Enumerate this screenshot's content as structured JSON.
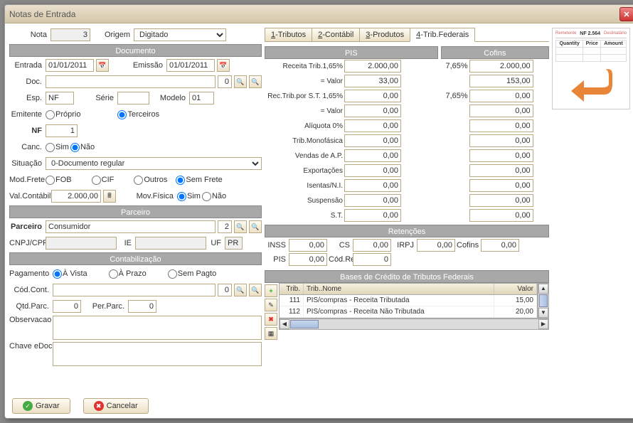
{
  "title": "Notas de Entrada",
  "header": {
    "nota_lbl": "Nota",
    "nota": "3",
    "origem_lbl": "Origem",
    "origem": "Digitado"
  },
  "tabs": [
    "1-Tributos",
    "2-Contábil",
    "3-Produtos",
    "4-Trib.Federais"
  ],
  "documento": {
    "hdr": "Documento",
    "entrada_lbl": "Entrada",
    "entrada": "01/01/2011",
    "emissao_lbl": "Emissão",
    "emissao": "01/01/2011",
    "doc_lbl": "Doc.",
    "doc": "",
    "doc_code": "0",
    "esp_lbl": "Esp.",
    "esp": "NF",
    "serie_lbl": "Série",
    "serie": "",
    "modelo_lbl": "Modelo",
    "modelo": "01",
    "emitente_lbl": "Emitente",
    "emitente_opts": [
      "Próprio",
      "Terceiros"
    ],
    "emitente_sel": 1,
    "nf_lbl": "NF",
    "nf": "1",
    "canc_lbl": "Canc.",
    "canc_opts": [
      "Sim",
      "Não"
    ],
    "canc_sel": 1,
    "situacao_lbl": "Situação",
    "situacao": "0-Documento regular",
    "modfrete_lbl": "Mod.Frete",
    "modfrete_opts": [
      "FOB",
      "CIF",
      "Outros",
      "Sem Frete"
    ],
    "modfrete_sel": 3,
    "valcontabil_lbl": "Val.Contábil",
    "valcontabil": "2.000,00",
    "movfisica_lbl": "Mov.Física",
    "movfisica_opts": [
      "Sim",
      "Não"
    ],
    "movfisica_sel": 0
  },
  "parceiro": {
    "hdr": "Parceiro",
    "parc_lbl": "Parceiro",
    "parc": "Consumidor",
    "parc_code": "2",
    "cnpj_lbl": "CNPJ/CPF",
    "cnpj": "",
    "ie_lbl": "IE",
    "ie": "",
    "uf_lbl": "UF",
    "uf": "PR"
  },
  "contab": {
    "hdr": "Contabilização",
    "pag_lbl": "Pagamento",
    "pag_opts": [
      "À Vista",
      "À Prazo",
      "Sem Pagto"
    ],
    "pag_sel": 0,
    "codcont_lbl": "Cód.Cont.",
    "codcont": "",
    "codcont_code": "0",
    "qtdparc_lbl": "Qtd.Parc.",
    "qtdparc": "0",
    "perparc_lbl": "Per.Parc.",
    "perparc": "0",
    "obs_lbl": "Observacao",
    "obs": "",
    "chave_lbl": "Chave eDoc",
    "chave": ""
  },
  "pis": {
    "hdr": "PIS",
    "rows": [
      {
        "lbl": "Receita Trib.1,65%",
        "v": "2.000,00"
      },
      {
        "lbl": "= Valor",
        "v": "33,00"
      },
      {
        "lbl": "Rec.Trib.por S.T. 1,65%",
        "v": "0,00"
      },
      {
        "lbl": "= Valor",
        "v": "0,00"
      },
      {
        "lbl": "Alíquota 0%",
        "v": "0,00"
      },
      {
        "lbl": "Trib.Monofásica",
        "v": "0,00"
      },
      {
        "lbl": "Vendas de A.P.",
        "v": "0,00"
      },
      {
        "lbl": "Exportações",
        "v": "0,00"
      },
      {
        "lbl": "Isentas/N.I.",
        "v": "0,00"
      },
      {
        "lbl": "Suspensão",
        "v": "0,00"
      },
      {
        "lbl": "S.T.",
        "v": "0,00"
      }
    ]
  },
  "cofins": {
    "hdr": "Cofins",
    "rows": [
      {
        "lbl": "7,65%",
        "v": "2.000,00"
      },
      {
        "lbl": "",
        "v": "153,00"
      },
      {
        "lbl": "7,65%",
        "v": "0,00"
      },
      {
        "lbl": "",
        "v": "0,00"
      },
      {
        "lbl": "",
        "v": "0,00"
      },
      {
        "lbl": "",
        "v": "0,00"
      },
      {
        "lbl": "",
        "v": "0,00"
      },
      {
        "lbl": "",
        "v": "0,00"
      },
      {
        "lbl": "",
        "v": "0,00"
      },
      {
        "lbl": "",
        "v": "0,00"
      },
      {
        "lbl": "",
        "v": "0,00"
      }
    ]
  },
  "retencoes": {
    "hdr": "Retenções",
    "items": [
      {
        "lbl": "INSS",
        "v": "0,00"
      },
      {
        "lbl": "CS",
        "v": "0,00"
      },
      {
        "lbl": "IRPJ",
        "v": "0,00"
      },
      {
        "lbl": "Cofins",
        "v": "0,00"
      },
      {
        "lbl": "PIS",
        "v": "0,00"
      },
      {
        "lbl": "Cód.Ret.",
        "v": "0"
      }
    ]
  },
  "bases": {
    "hdr": "Bases de Crédito de Tributos Federais",
    "cols": [
      "Trib.",
      "Trib..Nome",
      "Valor"
    ],
    "rows": [
      {
        "c1": "111",
        "c2": "PIS/compras - Receita Tributada",
        "c3": "15,00"
      },
      {
        "c1": "112",
        "c2": "PIS/compras - Receita Não Tributada",
        "c3": "20,00"
      }
    ]
  },
  "preview": {
    "left": "Remetente",
    "right": "Destinatário",
    "title": "NF 2.564",
    "cols": [
      "Quantity",
      "Price",
      "Amount"
    ]
  },
  "buttons": {
    "gravar": "Gravar",
    "cancelar": "Cancelar"
  }
}
